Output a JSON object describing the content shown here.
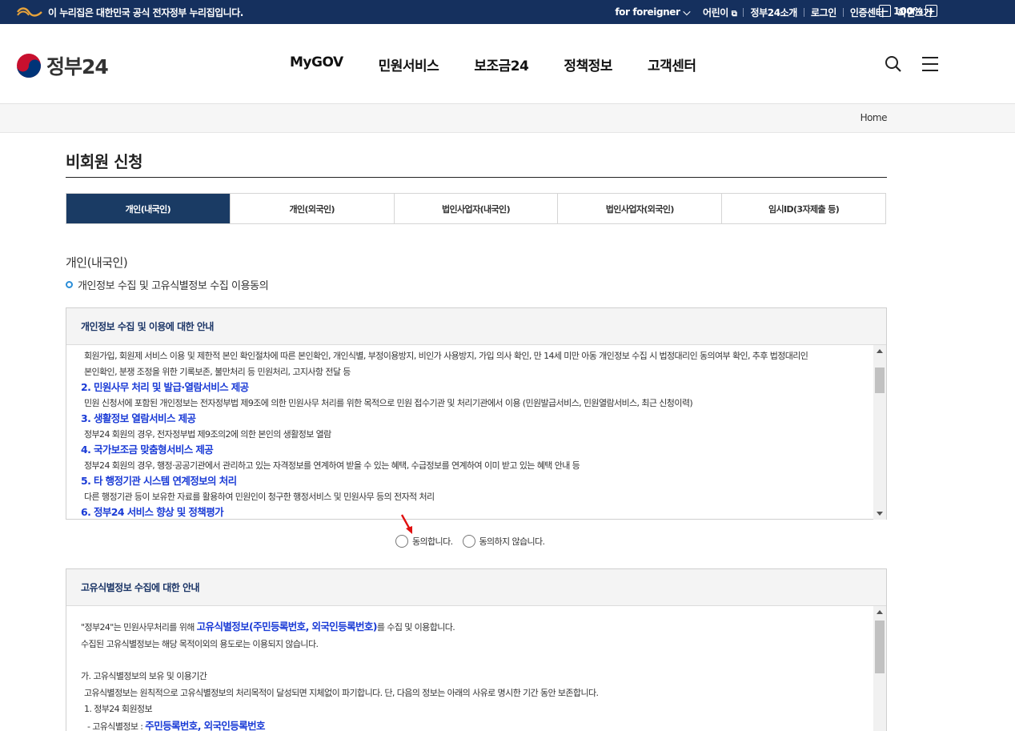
{
  "topbar": {
    "notice": "이 누리집은 대한민국 공식 전자정부 누리집입니다.",
    "links": [
      "for foreigner",
      "어린이",
      "정부24소개",
      "로그인",
      "인증센터",
      "화면크기"
    ],
    "zoom_minus": "−",
    "zoom": "100%",
    "zoom_plus": "+"
  },
  "header": {
    "logo_text": "정부24",
    "menu": [
      "MyGOV",
      "민원서비스",
      "보조금24",
      "정책정보",
      "고객센터"
    ]
  },
  "breadcrumb": {
    "home": "Home"
  },
  "page": {
    "title": "비회원 신청",
    "tabs": [
      "개인(내국인)",
      "개인(외국인)",
      "법인사업자(내국인)",
      "법인사업자(외국인)",
      "임시ID(3자제출 등)"
    ],
    "active_tab": 0,
    "section_label": "개인(내국인)",
    "consent_heading": "개인정보 수집 및 고유식별정보 수집 이용동의"
  },
  "privacy_box": {
    "heading": "개인정보 수집 및 이용에 대한 안내",
    "lines": [
      {
        "type": "desc",
        "text": "회원가입, 회원제 서비스 이용 및 제한적 본인 확인절차에 따른 본인확인, 개인식별, 부정이용방지, 비인가 사용방지, 가입 의사 확인, 만 14세 미만 아동 개인정보 수집 시 법정대리인 동의여부 확인, 추후 법정대리인"
      },
      {
        "type": "desc",
        "text": "본인확인, 분쟁 조정을 위한 기록보존, 불만처리 등 민원처리, 고지사항 전달 등"
      },
      {
        "type": "title",
        "text": "2. 민원사무 처리 및 발급·열람서비스 제공"
      },
      {
        "type": "desc",
        "text": "민원 신청서에 포함된 개인정보는 전자정부법 제9조에 의한 민원사무 처리를 위한 목적으로 민원 접수기관 및 처리기관에서 이용 (민원발급서비스, 민원열람서비스, 최근 신청이력)"
      },
      {
        "type": "title",
        "text": "3. 생활정보 열람서비스 제공"
      },
      {
        "type": "desc",
        "text": "정부24 회원의 경우, 전자정부법 제9조의2에 의한 본인의 생활정보 열람"
      },
      {
        "type": "title",
        "text": "4. 국가보조금 맞춤형서비스 제공"
      },
      {
        "type": "desc",
        "text": "정부24 회원의 경우, 행정·공공기관에서 관리하고 있는 자격정보를 연계하여 받을 수 있는 혜택, 수급정보를 연계하여 이미 받고 있는 혜택 안내 등"
      },
      {
        "type": "title",
        "text": "5. 타 행정기관 시스템 연계정보의 처리"
      },
      {
        "type": "desc",
        "text": "다른 행정기관 등이 보유한 자료를 활용하여 민원인이 청구한 행정서비스 및 민원사무 등의 전자적 처리"
      },
      {
        "type": "title",
        "text": "6. 정부24 서비스 향상 및 정책평가"
      }
    ]
  },
  "consent": {
    "agree": "동의합니다.",
    "disagree": "동의하지 않습니다."
  },
  "unique_box": {
    "heading": "고유식별정보 수집에 대한 안내",
    "line1_prefix": "\"정부24\"는 민원사무처리를 위해 ",
    "line1_strong": "고유식별정보(주민등록번호, 외국인등록번호)",
    "line1_suffix": "를 수집 및 이용합니다.",
    "line2": "수집된 고유식별정보는 해당 목적이외의 용도로는 이용되지 않습니다.",
    "line3": "가. 고유식별정보의 보유 및 이용기간",
    "line4": "고유식별정보는 원칙적으로 고유식별정보의 처리목적이 달성되면 지체없이 파기합니다. 단, 다음의 정보는 아래의 사유로 명시한 기간 동안 보존합니다.",
    "line5": "1. 정부24 회원정보",
    "line6_prefix": "- 고유식별정보 : ",
    "line6_strong": "주민등록번호, 외국인등록번호"
  }
}
